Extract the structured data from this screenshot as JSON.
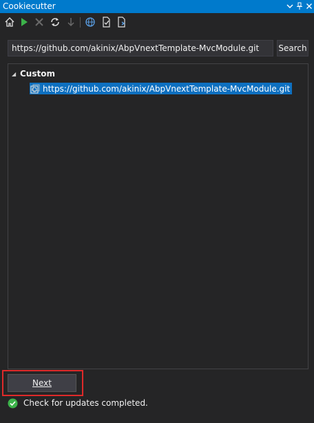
{
  "window": {
    "title": "Cookiecutter",
    "controls": [
      "chevron-down-icon",
      "pin-icon",
      "close-icon"
    ]
  },
  "toolbar": {
    "items": [
      {
        "name": "home-icon",
        "enabled": true
      },
      {
        "name": "run-icon",
        "enabled": true
      },
      {
        "name": "delete-icon",
        "enabled": false
      },
      {
        "name": "refresh-icon",
        "enabled": true
      },
      {
        "name": "download-icon",
        "enabled": false
      },
      {
        "name": "globe-icon",
        "enabled": true
      },
      {
        "name": "check-file-icon",
        "enabled": true
      },
      {
        "name": "new-file-icon",
        "enabled": true
      }
    ]
  },
  "search": {
    "value": "https://github.com/akinix/AbpVnextTemplate-MvcModule.git",
    "button_label": "Search"
  },
  "tree": {
    "group_label": "Custom",
    "items": [
      {
        "label": "https://github.com/akinix/AbpVnextTemplate-MvcModule.git",
        "icon": "template-icon",
        "selected": true
      }
    ]
  },
  "footer": {
    "next_label": "Next",
    "status_text": "Check for updates completed."
  },
  "colors": {
    "accent": "#007acc",
    "selection": "#0e70c0",
    "highlight_box": "#e02a2a",
    "success": "#3cb34a"
  }
}
